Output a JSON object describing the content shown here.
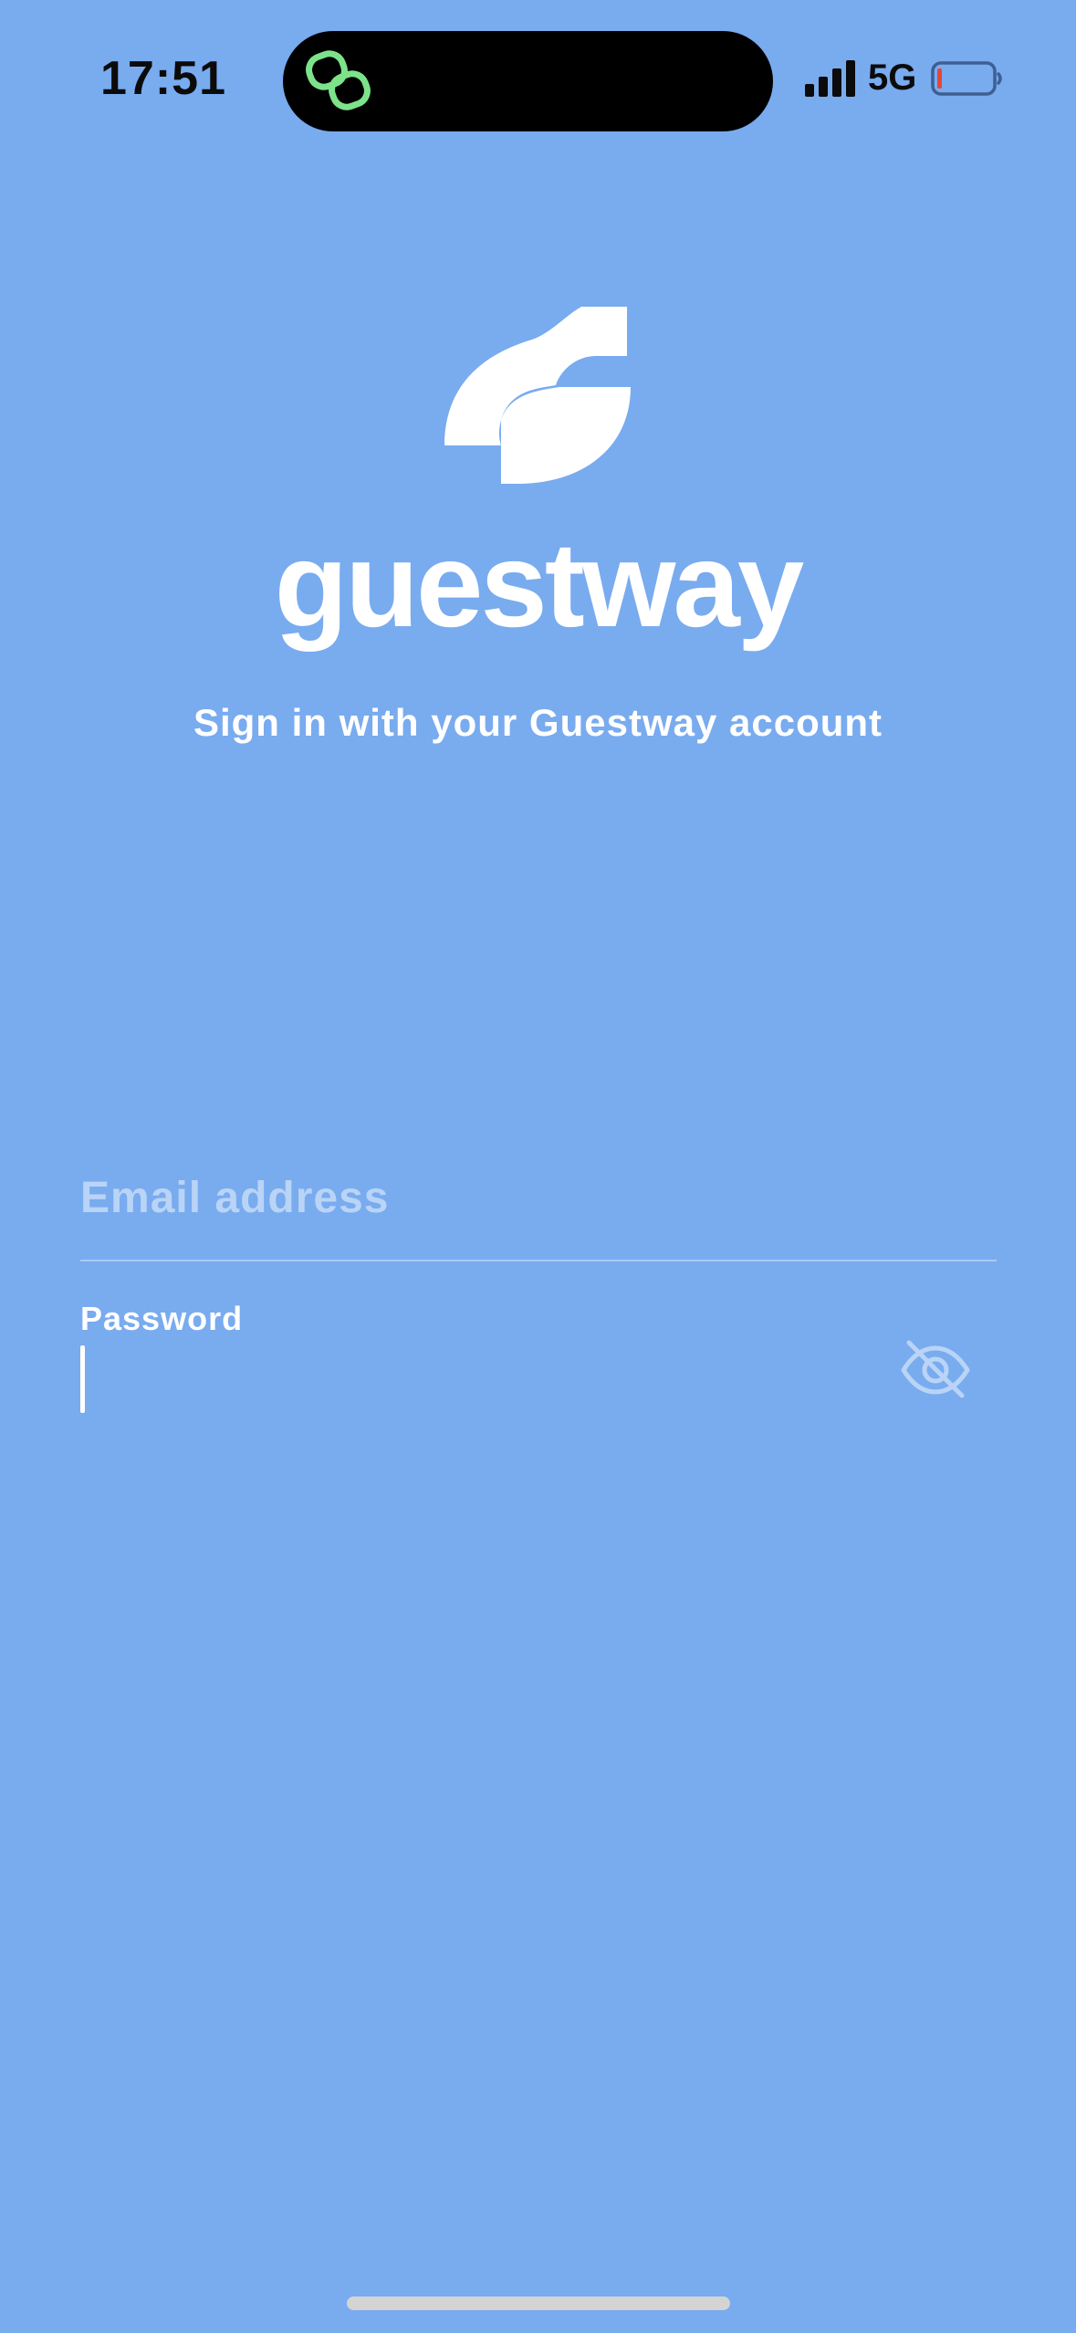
{
  "status_bar": {
    "time": "17:51",
    "network": "5G",
    "signal_icon": "cellular-signal-icon",
    "battery_icon": "battery-low-icon",
    "island_app_icon": "linked-rings-icon",
    "battery_level": 0.05
  },
  "brand": {
    "logo_icon": "guestway-logo-icon",
    "name": "guestway"
  },
  "subtitle": "Sign in with your Guestway account",
  "form": {
    "email": {
      "placeholder": "Email address",
      "value": ""
    },
    "password": {
      "label": "Password",
      "value": "",
      "toggle_icon": "eye-slash-icon"
    }
  },
  "colors": {
    "background": "#79abef",
    "text": "#ffffff",
    "placeholder": "#b9d4f6",
    "island_icon": "#7de38a"
  }
}
